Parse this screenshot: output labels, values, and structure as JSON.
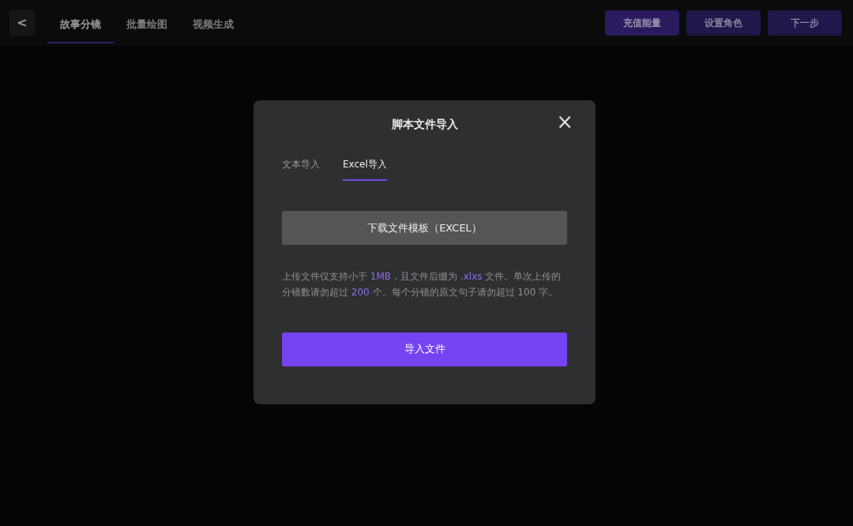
{
  "topbar": {
    "back_button": "<",
    "tabs": [
      {
        "label": "故事分镜",
        "selected": true
      },
      {
        "label": "批量绘图",
        "selected": false
      },
      {
        "label": "视频生成",
        "selected": false
      }
    ],
    "buttons": [
      {
        "label": "充值能量",
        "disabled": false
      },
      {
        "label": "设置角色",
        "disabled": true
      },
      {
        "label": "下一步",
        "disabled": true
      }
    ]
  },
  "dialog": {
    "title": "脚本文件导入",
    "close": "×",
    "tabs": [
      {
        "label": "文本导入",
        "selected": false
      },
      {
        "label": "Excel导入",
        "selected": true
      }
    ],
    "download_button": "下载文件模板（EXCEL）",
    "note": [
      {
        "text": "上传文件仅支持小于 ",
        "highlight": false
      },
      {
        "text": "1MB",
        "highlight": true
      },
      {
        "text": "，且文件后缀为 ",
        "highlight": false
      },
      {
        "text": ".xlxs",
        "highlight": true
      },
      {
        "text": " 文件。单次上传的分镜数请勿超过 ",
        "highlight": false
      },
      {
        "text": "200",
        "highlight": true
      },
      {
        "text": " 个。每个分镜的原文句子请勿超过 100 字。",
        "highlight": false
      }
    ],
    "import_button": "导入文件"
  }
}
